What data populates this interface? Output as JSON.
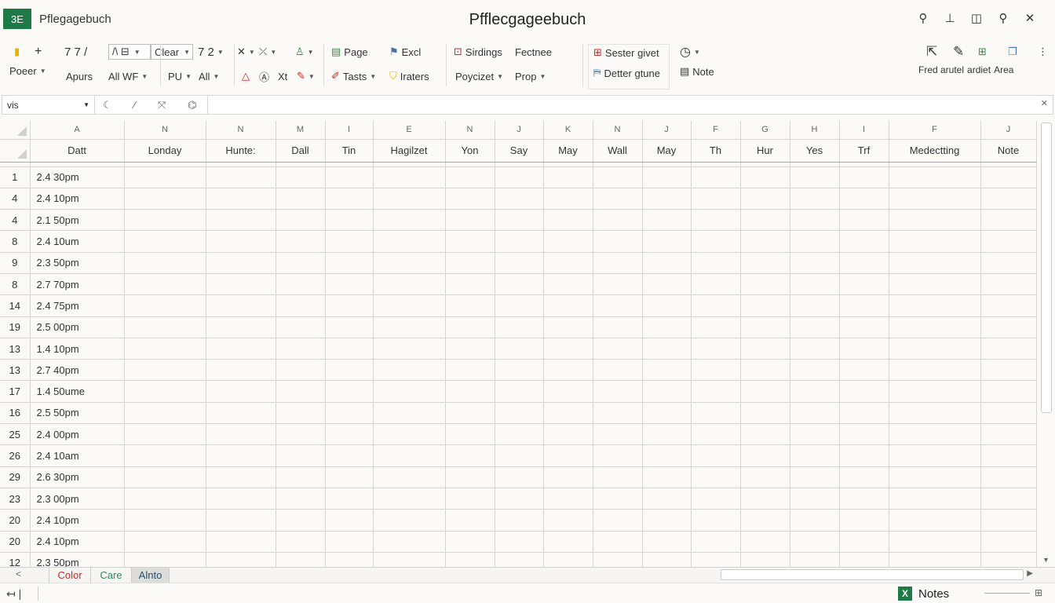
{
  "titlebar": {
    "app_badge": "3E",
    "app_name": "Pflegagebuch",
    "doc_title": "Pfflecgageebuch",
    "controls": [
      {
        "name": "search-icon",
        "glyph": "⚲"
      },
      {
        "name": "pin-icon",
        "glyph": "⊥"
      },
      {
        "name": "restore-icon",
        "glyph": "◫"
      },
      {
        "name": "zoom-icon",
        "glyph": "⚲"
      },
      {
        "name": "close-icon",
        "glyph": "✕"
      }
    ]
  },
  "ribbon": {
    "paste_label": "Poeer",
    "plus": "+",
    "font_sizes": "7 7 /",
    "font_box": "/\\ ⊟",
    "clear": "Clear",
    "num": "7 2",
    "apurs": "Apurs",
    "all_wf": "All WF",
    "pu": "PU",
    "all": "All",
    "xt": "Xt",
    "page": "Page",
    "excl": "Excl",
    "tasts": "Tasts",
    "iraters": "Iraters",
    "sirdings": "Sirdings",
    "fectnee": "Fectnee",
    "poycizet": "Poycizet",
    "prop": "Prop",
    "sester_givet": "Sester givet",
    "detter_gtune": "Detter gtune",
    "note": "Note",
    "fred_arutel": "Fred arutel",
    "ardiet": "ardiet",
    "area": "Area"
  },
  "formula_bar": {
    "name_box": "vis"
  },
  "sheet": {
    "column_letters": [
      "A",
      "N",
      "N",
      "M",
      "I",
      "E",
      "N",
      "J",
      "K",
      "N",
      "J",
      "F",
      "G",
      "H",
      "I",
      "F",
      "J"
    ],
    "headers": [
      "Datt",
      "Londay",
      "Hunte:",
      "Dall",
      "Tin",
      "Hagilzet",
      "Yon",
      "Say",
      "May",
      "Wall",
      "May",
      "Th",
      "Hur",
      "Yes",
      "Trf",
      "Medectting",
      "Note"
    ],
    "rows": [
      {
        "num": "1",
        "date": "2.4 30pm"
      },
      {
        "num": "4",
        "date": "2.4 10pm"
      },
      {
        "num": "4",
        "date": "2.1 50pm"
      },
      {
        "num": "8",
        "date": "2.4 10um"
      },
      {
        "num": "9",
        "date": "2.3 50pm"
      },
      {
        "num": "8",
        "date": "2.7 70pm"
      },
      {
        "num": "14",
        "date": "2.4 75pm"
      },
      {
        "num": "19",
        "date": "2.5 00pm"
      },
      {
        "num": "13",
        "date": "1.4 10pm"
      },
      {
        "num": "13",
        "date": "2.7 40pm"
      },
      {
        "num": "17",
        "date": "1.4 50ume"
      },
      {
        "num": "16",
        "date": "2.5 50pm"
      },
      {
        "num": "25",
        "date": "2.4 00pm"
      },
      {
        "num": "26",
        "date": "2.4 10am"
      },
      {
        "num": "29",
        "date": "2.6 30pm"
      },
      {
        "num": "23",
        "date": "2.3 00pm"
      },
      {
        "num": "20",
        "date": "2.4 10pm"
      },
      {
        "num": "20",
        "date": "2.4 10pm"
      },
      {
        "num": "12",
        "date": "2.3 50pm"
      }
    ]
  },
  "tabs": {
    "nav": "<",
    "items": [
      "Color",
      "Care",
      "Alnto"
    ]
  },
  "status": {
    "left": "↤ |",
    "notes": "Notes",
    "xl": "X",
    "right": "⊞"
  }
}
